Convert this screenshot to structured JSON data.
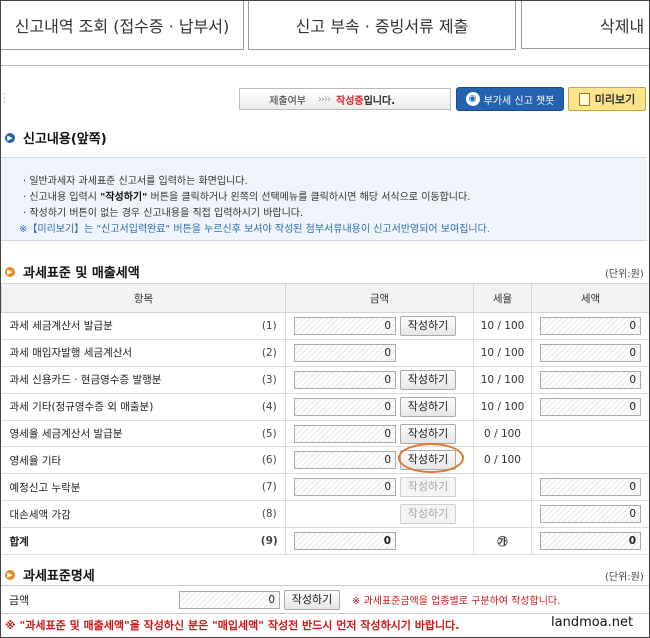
{
  "tabs": [
    "신고내역 조회 (접수증 · 납부서)",
    "신고 부속 · 증빙서류 제출",
    "삭제내"
  ],
  "status": {
    "label": "제출여부",
    "arrows": "››››",
    "value": "작성중",
    "suffix": "입니다."
  },
  "buttons": {
    "chatbot": "부가세 신고 챗봇",
    "preview": "미리보기",
    "write": "작성하기"
  },
  "section1": {
    "title": "신고내용(앞쪽)"
  },
  "info": {
    "line1": "일반과세자 과세표준 신고서를 입력하는 화면입니다.",
    "line2_a": "신고내용 입력시 ",
    "line2_b": "\"작성하기\"",
    "line2_c": " 버튼을 클릭하거나 왼쪽의 선택메뉴를 클릭하시면 해당 서식으로 이동합니다.",
    "line3": "작성하기 버튼이 없는 경우 신고내용을 직접 입력하시기 바랍니다.",
    "line4": "※【미리보기】는 \"신고서입력완료\" 버튼을 누르신후 보셔야 작성된 첨부서류내용이 신고서반영되어 보여집니다."
  },
  "section2": {
    "title": "과세표준 및 매출세액",
    "unit": "(단위:원)"
  },
  "table": {
    "headers": [
      "항목",
      "금액",
      "세율",
      "세액"
    ],
    "rows": [
      {
        "label": "과세 세금계산서 발급분",
        "no": "(1)",
        "amount": "0",
        "btn": "on",
        "rate": "10 / 100",
        "tax": "0"
      },
      {
        "label": "과세 매입자발행 세금계산서",
        "no": "(2)",
        "amount": "0",
        "btn": "none",
        "rate": "10 / 100",
        "tax": "0"
      },
      {
        "label": "과세 신용카드 · 현금영수증 발행분",
        "no": "(3)",
        "amount": "0",
        "btn": "on",
        "rate": "10 / 100",
        "tax": "0"
      },
      {
        "label": "과세 기타(정규영수증 외 매출분)",
        "no": "(4)",
        "amount": "0",
        "btn": "on",
        "rate": "10 / 100",
        "tax": "0"
      },
      {
        "label": "영세율 세금계산서 발급분",
        "no": "(5)",
        "amount": "0",
        "btn": "on",
        "rate": "0 / 100",
        "tax": ""
      },
      {
        "label": "영세율 기타",
        "no": "(6)",
        "amount": "0",
        "btn": "on",
        "rate": "0 / 100",
        "tax": ""
      },
      {
        "label": "예정신고 누락분",
        "no": "(7)",
        "amount": "0",
        "btn": "off",
        "rate": "",
        "tax": "0"
      },
      {
        "label": "대손세액 가감",
        "no": "(8)",
        "amount": "",
        "btn": "off",
        "rate": "",
        "tax": "0"
      },
      {
        "label": "합계",
        "no": "(9)",
        "amount": "0",
        "btn": "none",
        "rate": "㉮",
        "tax": "0"
      }
    ]
  },
  "section3": {
    "title": "과세표준명세",
    "unit": "(단위:원)"
  },
  "detail": {
    "label": "금액",
    "amount": "0",
    "note": "※ 과세표준금액을 업종별로 구분하여 작성합니다."
  },
  "footer_note": "※ \"과세표준 및 매출세액\"을 작성하신 분은 \"매입세액\" 작성전 반드시 먼저 작성하시기 바랍니다.",
  "watermark": "landmoa.net",
  "colors": {
    "accent": "#2563b0",
    "warn": "#d01717",
    "highlight": "#e07a33",
    "preview": "#fde48a"
  }
}
